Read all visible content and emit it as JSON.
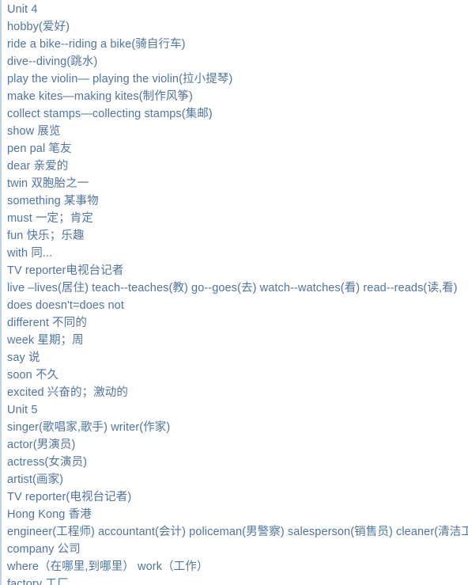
{
  "document": {
    "type": "vocabulary-list",
    "text_color": "#4f74a3",
    "background_color": "#ffffff",
    "left_border_color": "#bcd4e8",
    "lines": [
      {
        "text": "Unit 4",
        "is_section": true
      },
      {
        "text": "hobby(爱好)",
        "is_section": false
      },
      {
        "text": "ride a bike--riding a bike(骑自行车)",
        "is_section": false
      },
      {
        "text": "dive--diving(跳水)",
        "is_section": false
      },
      {
        "text": "play the violin— playing the violin(拉小提琴)",
        "is_section": false
      },
      {
        "text": "make kites—making kites(制作风筝)",
        "is_section": false
      },
      {
        "text": "collect stamps—collecting stamps(集邮)",
        "is_section": false
      },
      {
        "text": "show 展览",
        "is_section": false
      },
      {
        "text": "pen pal 笔友",
        "is_section": false
      },
      {
        "text": "dear 亲爱的",
        "is_section": false
      },
      {
        "text": "twin 双胞胎之一",
        "is_section": false
      },
      {
        "text": "something 某事物",
        "is_section": false
      },
      {
        "text": "must 一定；肯定",
        "is_section": false
      },
      {
        "text": "fun 快乐；乐趣",
        "is_section": false
      },
      {
        "text": "with 同...",
        "is_section": false
      },
      {
        "text": "TV reporter电视台记者",
        "is_section": false
      },
      {
        "text": "live –lives(居住) teach--teaches(教) go--goes(去) watch--watches(看) read--reads(读,看)",
        "is_section": false
      },
      {
        "text": "does doesn't=does not",
        "is_section": false
      },
      {
        "text": "different 不同的",
        "is_section": false
      },
      {
        "text": "week 星期；周",
        "is_section": false
      },
      {
        "text": "say 说",
        "is_section": false
      },
      {
        "text": "soon 不久",
        "is_section": false
      },
      {
        "text": "excited 兴奋的；激动的",
        "is_section": false
      },
      {
        "text": "Unit 5",
        "is_section": true
      },
      {
        "text": "singer(歌唱家,歌手) writer(作家)",
        "is_section": false
      },
      {
        "text": "actor(男演员)",
        "is_section": false
      },
      {
        "text": "actress(女演员)",
        "is_section": false
      },
      {
        "text": "artist(画家)",
        "is_section": false
      },
      {
        "text": "TV reporter(电视台记者)",
        "is_section": false
      },
      {
        "text": "Hong Kong 香港",
        "is_section": false
      },
      {
        "text": "engineer(工程师) accountant(会计) policeman(男警察) salesperson(销售员) cleaner(清洁工)",
        "is_section": false
      },
      {
        "text": "company 公司",
        "is_section": false
      },
      {
        "text": "where（在哪里,到哪里） work（工作）",
        "is_section": false
      },
      {
        "text": "factory 工厂",
        "is_section": false
      }
    ]
  }
}
